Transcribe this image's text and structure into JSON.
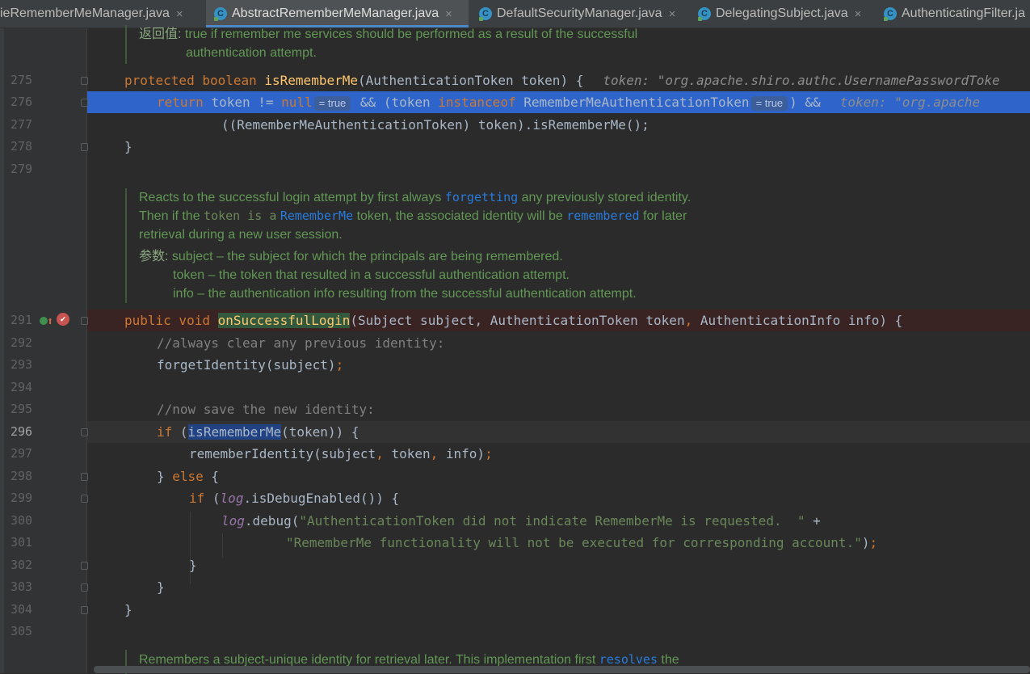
{
  "tabs": [
    {
      "label": "ieRememberMeManager.java",
      "active": false
    },
    {
      "label": "AbstractRememberMeManager.java",
      "active": true
    },
    {
      "label": "DefaultSecurityManager.java",
      "active": false
    },
    {
      "label": "DelegatingSubject.java",
      "active": false
    },
    {
      "label": "AuthenticatingFilter.ja",
      "active": false
    }
  ],
  "icons": {
    "tab_class": "C",
    "tab_close": "×"
  },
  "doc_top": {
    "tag": "返回值:",
    "line1": "true if remember me services should be performed as a result of the successful",
    "line2": "authentication attempt."
  },
  "line_numbers": [
    "275",
    "276",
    "277",
    "278",
    "279",
    "291",
    "292",
    "293",
    "294",
    "295",
    "296",
    "297",
    "298",
    "299",
    "300",
    "301",
    "302",
    "303",
    "304",
    "305"
  ],
  "code": {
    "l275": {
      "kw": "protected boolean ",
      "fn": "isRememberMe",
      "rest": "(AuthenticationToken token) {",
      "hint": "token: \"org.apache.shiro.authc.UsernamePasswordToke"
    },
    "l276": {
      "kw1": "return ",
      "t1": "token != ",
      "kw2": "null",
      "inlay1": "= true",
      "t2": " && (token ",
      "kw3": "instanceof",
      "t3": " RememberMeAuthenticationToken",
      "inlay2": "= true",
      "t4": ") &&",
      "hint": "token: \"org.apache"
    },
    "l277": {
      "text": "((RememberMeAuthenticationToken) token).isRememberMe();"
    },
    "l278": {
      "text": "}"
    },
    "l291": {
      "kw": "public void ",
      "fn": "onSuccessfulLogin",
      "rest": "(Subject subject, AuthenticationToken token",
      "comma": ",",
      "rest2": " AuthenticationInfo info) {"
    },
    "l292": {
      "comment": "//always clear any previous identity:"
    },
    "l293": {
      "text": "forgetIdentity(subject)",
      "semi": ";"
    },
    "l295": {
      "comment": "//now save the new identity:"
    },
    "l296": {
      "kw": "if ",
      "p1": "(",
      "fn": "isRememberMe",
      "rest": "(token)) {"
    },
    "l297": {
      "t1": "rememberIdentity(subject",
      "c1": ",",
      "t2": " token",
      "c2": ",",
      "t3": " info)",
      "semi": ";"
    },
    "l298": {
      "t1": "} ",
      "kw": "else",
      "t2": " {"
    },
    "l299": {
      "kw": "if ",
      "p1": "(",
      "lg": "log",
      "rest": ".isDebugEnabled()) {"
    },
    "l300": {
      "lg": "log",
      "t1": ".debug(",
      "str": "\"AuthenticationToken did not indicate RememberMe is requested.  \"",
      "t2": " +"
    },
    "l301": {
      "str": "\"RememberMe functionality will not be executed for corresponding account.\"",
      "t1": ")",
      "semi": ";"
    },
    "l302": {
      "text": "}"
    },
    "l303": {
      "text": "}"
    },
    "l304": {
      "text": "}"
    }
  },
  "doc_mid": {
    "l1_a": "Reacts to the successful login attempt by first always ",
    "l1_link": "forgetting",
    "l1_b": " any previously stored identity.",
    "l2_a": "Then if the ",
    "l2_code": "token is a",
    "l2_link": "RememberMe",
    "l2_b": " token, the associated identity will be ",
    "l2_link2": "remembered",
    "l2_c": " for later",
    "l3": "retrieval during a new user session.",
    "params_tag": "参数:",
    "p1": "subject – the subject for which the principals are being remembered.",
    "p2": "token – the token that resulted in a successful authentication attempt.",
    "p3": "info – the authentication info resulting from the successful authentication attempt."
  },
  "doc_bottom": {
    "a": "Remembers a subject-unique identity for retrieval later. This implementation first ",
    "link": "resolves",
    "b": " the"
  },
  "gutter_icons": {
    "override": "⬆",
    "breakpoint": "✔"
  }
}
